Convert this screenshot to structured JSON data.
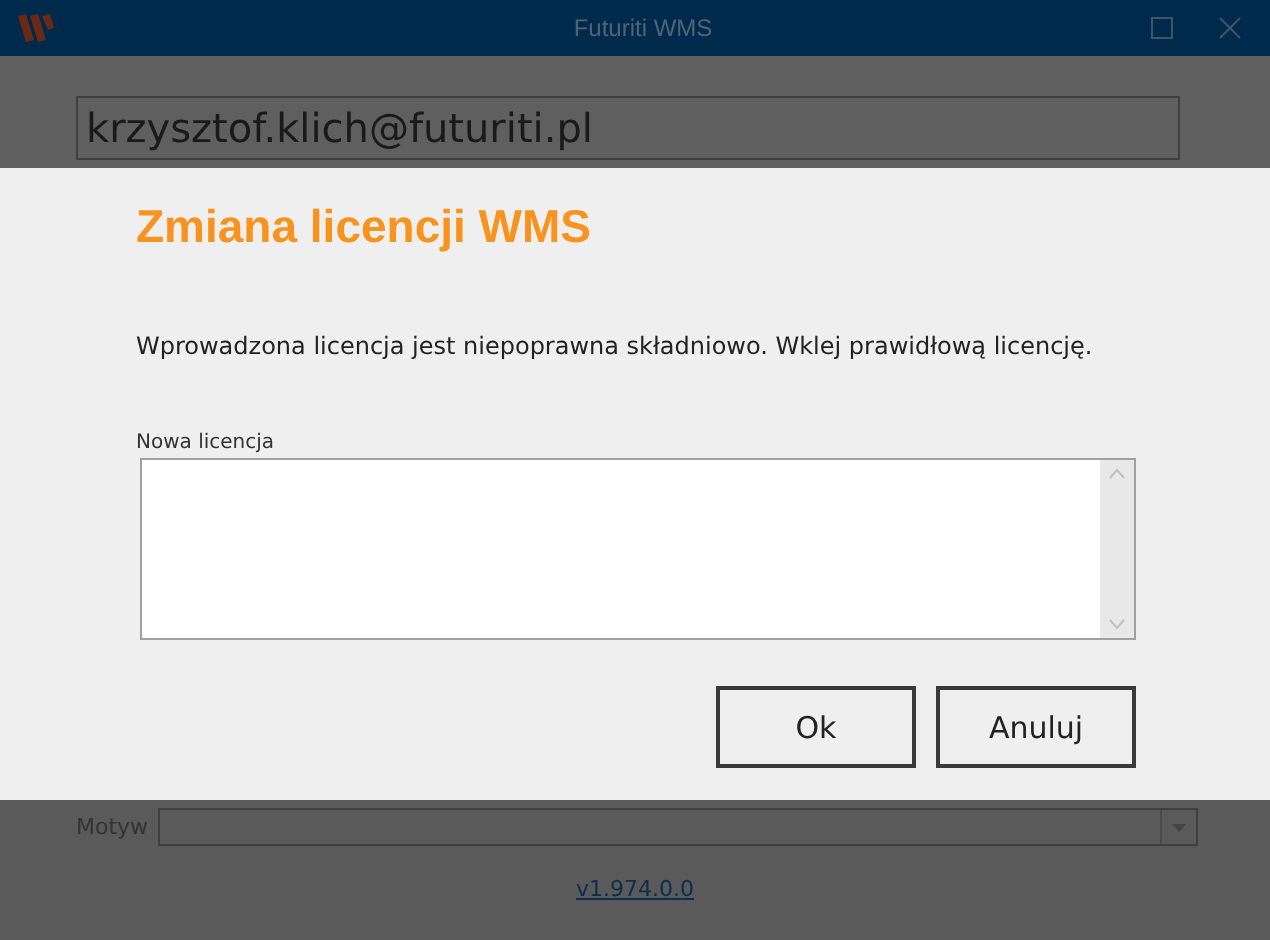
{
  "window": {
    "title": "Futuriti WMS"
  },
  "background": {
    "login_field": {
      "value": "krzysztof.klich@futuriti.pl"
    },
    "theme_field": {
      "label": "Motyw"
    },
    "version_link": "v1.974.0.0"
  },
  "dialog": {
    "title": "Zmiana licencji WMS",
    "message": "Wprowadzona licencja jest niepoprawna składniowo. Wklej prawidłową licencję.",
    "license_field": {
      "label": "Nowa licencja"
    },
    "buttons": [
      "Ok",
      "Anuluj"
    ]
  }
}
